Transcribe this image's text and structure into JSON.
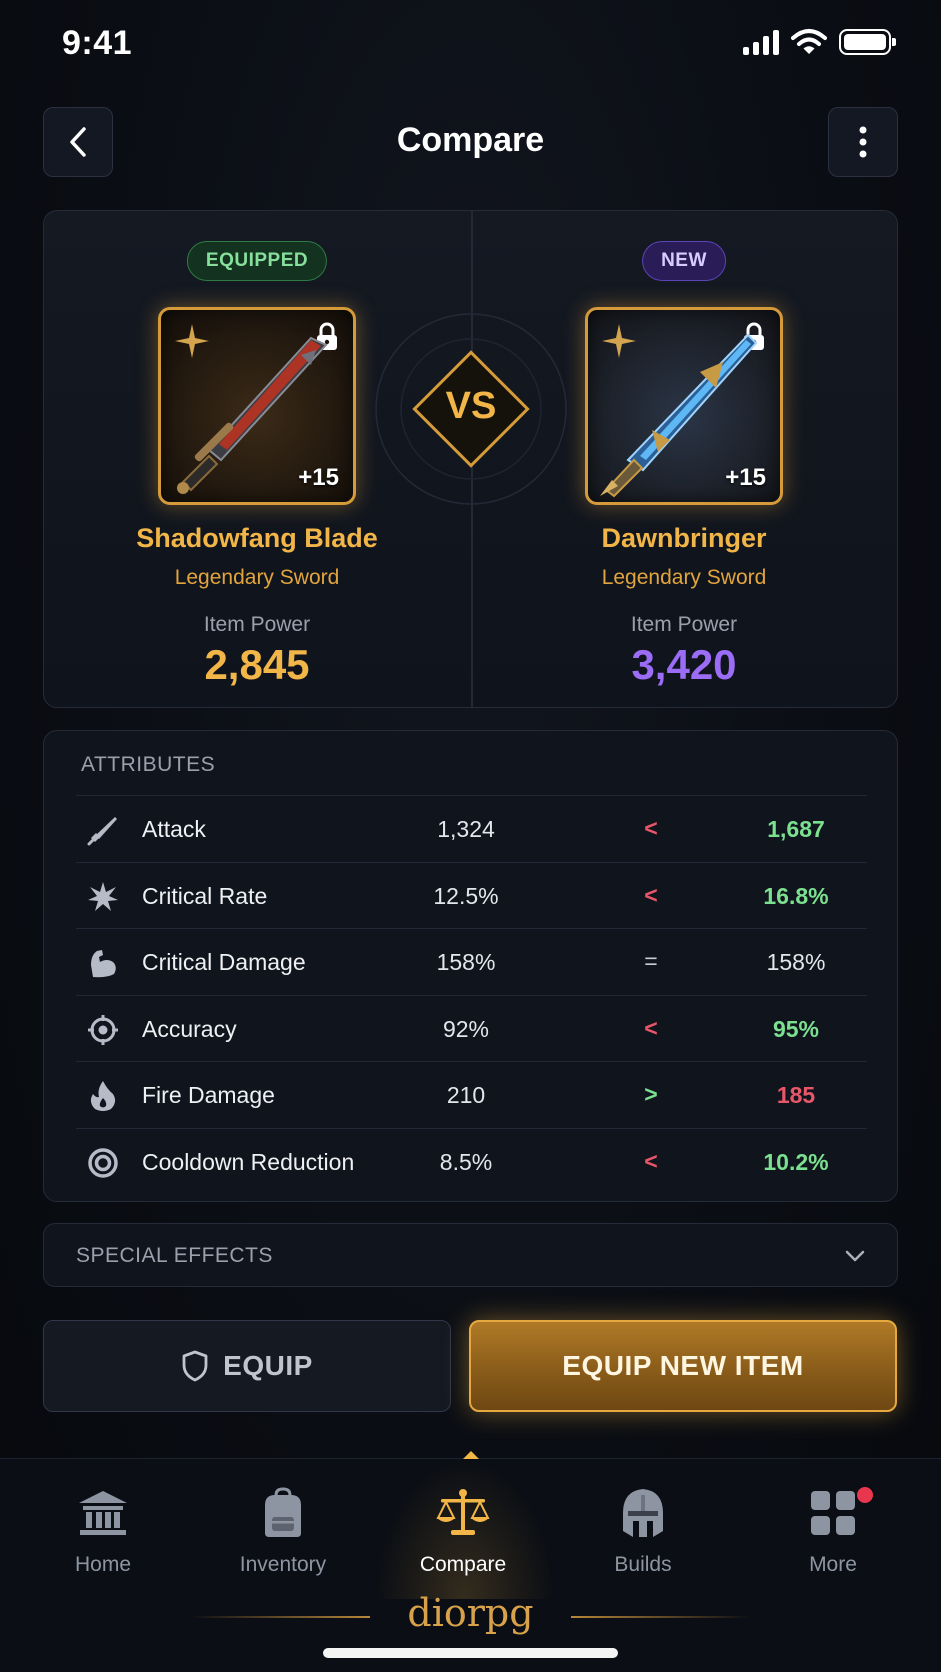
{
  "status_bar": {
    "time": "9:41"
  },
  "header": {
    "title": "Compare"
  },
  "equipped_item": {
    "badge": "EQUIPPED",
    "name": "Shadowfang Blade",
    "type": "Legendary Sword",
    "enhancement": "+15",
    "power_label": "Item Power",
    "power": "2,845"
  },
  "new_item": {
    "badge": "NEW",
    "name": "Dawnbringer",
    "type": "Legendary Sword",
    "enhancement": "+15",
    "power_label": "Item Power",
    "power": "3,420"
  },
  "vs_label": "VS",
  "attributes": {
    "title": "ATTRIBUTES",
    "rows": [
      {
        "icon": "sword-icon",
        "name": "Attack",
        "current": "1,324",
        "compare": "<",
        "new": "1,687",
        "status": "better"
      },
      {
        "icon": "burst-icon",
        "name": "Critical Rate",
        "current": "12.5%",
        "compare": "<",
        "new": "16.8%",
        "status": "better"
      },
      {
        "icon": "muscle-icon",
        "name": "Critical Damage",
        "current": "158%",
        "compare": "=",
        "new": "158%",
        "status": "equal"
      },
      {
        "icon": "crosshair-icon",
        "name": "Accuracy",
        "current": "92%",
        "compare": "<",
        "new": "95%",
        "status": "better"
      },
      {
        "icon": "flame-icon",
        "name": "Fire Damage",
        "current": "210",
        "compare": ">",
        "new": "185",
        "status": "worse"
      },
      {
        "icon": "cooldown-icon",
        "name": "Cooldown Reduction",
        "current": "8.5%",
        "compare": "<",
        "new": "10.2%",
        "status": "better"
      }
    ]
  },
  "special_effects": {
    "label": "SPECIAL EFFECTS"
  },
  "actions": {
    "equip": "EQUIP",
    "equip_new": "EQUIP NEW ITEM"
  },
  "tabs": [
    {
      "label": "Home",
      "icon": "bank-icon"
    },
    {
      "label": "Inventory",
      "icon": "backpack-icon"
    },
    {
      "label": "Compare",
      "icon": "scales-icon",
      "active": true
    },
    {
      "label": "Builds",
      "icon": "helmet-icon"
    },
    {
      "label": "More",
      "icon": "grid-icon"
    }
  ],
  "brand": "diorpg",
  "colors": {
    "gold": "#f1b548",
    "purple": "#9b6cf5",
    "better": "#7be08f",
    "worse": "#e8566a",
    "equal": "#e3e6eb"
  }
}
